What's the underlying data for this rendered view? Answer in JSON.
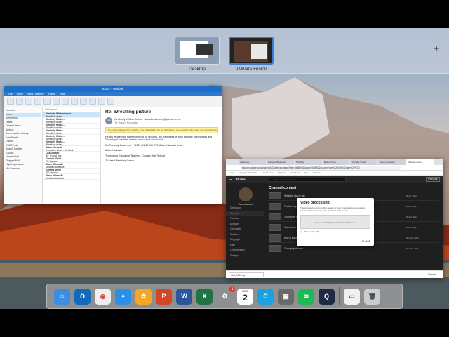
{
  "spaces": {
    "items": [
      {
        "label": "Desktop"
      },
      {
        "label": "VMware Fusion"
      }
    ],
    "add_symbol": "+"
  },
  "outlook": {
    "title": "Inbox - Outlook",
    "tabs": [
      "File",
      "Home",
      "Send / Receive",
      "Folder",
      "View"
    ],
    "folders": [
      "Favorites",
      "Inbox",
      "Sent Items",
      "Drafts",
      "Deleted Items",
      "Archive",
      "Conversation History",
      "Junk Email",
      "Outbox",
      "RSS Feeds",
      "Search Folders",
      "Groups",
      "Unread Mail",
      "Flagged Mail",
      "High Importance",
      "My Computer"
    ],
    "list_header": "All  Unread",
    "messages": [
      {
        "from": "Kimberly Wickenheiser",
        "subject": "Wrestling picture",
        "time": "12:32 PM"
      },
      {
        "from": "Kimberly Wicke...",
        "subject": "Wrestling picture",
        "time": "12:30 PM"
      },
      {
        "from": "Kimberly Wicke...",
        "subject": "Wrestling picture",
        "time": "12:28 PM"
      },
      {
        "from": "Kimberly Wicke...",
        "subject": "Wrestling picture",
        "time": "12:26 PM"
      },
      {
        "from": "Kimberly Wicke...",
        "subject": "Wrestling picture",
        "time": "11:57 AM"
      },
      {
        "from": "Kimberly Wicke...",
        "subject": "Wrestling picture",
        "time": "11:55 AM"
      },
      {
        "from": "Adam Kiovasis",
        "subject": "Education Week - Mt. Heal",
        "time": "Mon"
      },
      {
        "from": "Lisa Gordon",
        "subject": "Re: School day",
        "time": "Mon"
      },
      {
        "from": "Gemma Altieri",
        "subject": "PD Vacation",
        "time": "Mon"
      },
      {
        "from": "Stacy Ultimoski",
        "subject": "Updated schedule",
        "time": "Mon"
      },
      {
        "from": "Gemma Altieri",
        "subject": "PD Vacation",
        "time": "Mon"
      },
      {
        "from": "Stacy Ultimoski",
        "subject": "Updated schedule",
        "time": "Mon"
      }
    ],
    "reading": {
      "subject": "Re: Wrestling picture",
      "sender": "Kimberly Wickenheiser <kwickenheiser@yahoo.com>",
      "to": "To: Adam Kiovasis",
      "avatar_initials": "KW",
      "warning": "This email originated from outside of the organization. Do not click links or open attachments unless you recognize the sender and know the content is safe.",
      "body": [
        "He will certainly be there tomorrow for pictures. But next week let's do Monday, Wednesday and Thursday if possible. Let me know if that would work.",
        "On Tuesday, December 7, 2021, 11:32 AM EST, Adam Kiovasis wrote:",
        "Adam Kiovasis",
        "Technology Education Teacher - Country High School",
        "JV Head Wrestling Coach"
      ]
    }
  },
  "chrome": {
    "tabs": [
      "Classroom",
      "Managed Bookmarks",
      "Schedule",
      "Shared drives",
      "YouTube Studio",
      "Video processing",
      "Channel content"
    ],
    "url": "studio.youtube.com/channel/UC/videos/upload?filter=%5B%5D&sort=%7B%22columnType%22%3A%22date%22%7D",
    "bookmarks": [
      "Apps",
      "Managed Bookmarks",
      "Student Links",
      "Schedule",
      "Gradebook",
      "Drive",
      "Calendar"
    ],
    "yt": {
      "logo": "Studio",
      "search_placeholder": "Search across your channel",
      "create_label": "CREATE",
      "channel_name": "Your channel",
      "nav": [
        "Dashboard",
        "Content",
        "Playlists",
        "Analytics",
        "Comments",
        "Subtitles",
        "Copyright",
        "Earn",
        "Customization",
        "Settings"
      ],
      "heading": "Channel content",
      "rows": [
        {
          "title": "Wrestling picture day",
          "date": "Dec 7, 2021"
        },
        {
          "title": "Practice highlights",
          "date": "Dec 6, 2021"
        },
        {
          "title": "Technology lesson",
          "date": "Dec 3, 2021"
        },
        {
          "title": "Tournament recap",
          "date": "Dec 1, 2021"
        },
        {
          "title": "How to Make a Good Looking Slideshow",
          "date": "Nov 29, 2021"
        },
        {
          "title": "Class project demo",
          "date": "Nov 22, 2021"
        }
      ]
    },
    "download": {
      "item": "IMG_4521.mp4",
      "show_all": "Show all"
    }
  },
  "dialog": {
    "title": "Video processing",
    "description": "The standard definition (SD) version of your video is done processing. Check back later for the high definition (HD) version.",
    "preview_text": "How to Import Editing and Edit Fusion Videos in...",
    "progress": "Processing HD...",
    "close_label": "CLOSE"
  },
  "dock": {
    "items": [
      {
        "name": "finder",
        "color": "#3b8de0"
      },
      {
        "name": "outlook",
        "color": "#0f6cbd"
      },
      {
        "name": "chrome",
        "color": "#eeeeee"
      },
      {
        "name": "safari",
        "color": "#2a8fe8"
      },
      {
        "name": "photos",
        "color": "#f5a623"
      },
      {
        "name": "powerpoint",
        "color": "#d24726"
      },
      {
        "name": "word",
        "color": "#2b579a"
      },
      {
        "name": "excel",
        "color": "#217346"
      },
      {
        "name": "system-preferences",
        "color": "#8e8e93"
      },
      {
        "name": "calendar",
        "color": "#ffffff"
      },
      {
        "name": "clipchamp",
        "color": "#1ba1e2"
      },
      {
        "name": "vmware-fusion",
        "color": "#696969"
      },
      {
        "name": "spotify",
        "color": "#1db954"
      },
      {
        "name": "quicktime",
        "color": "#1f2a44"
      },
      {
        "name": "minimized-window",
        "color": "#f0f0f0"
      },
      {
        "name": "trash",
        "color": "#c9cdd2"
      }
    ],
    "calendar_month": "DEC",
    "calendar_day": "2",
    "badge": "1"
  }
}
